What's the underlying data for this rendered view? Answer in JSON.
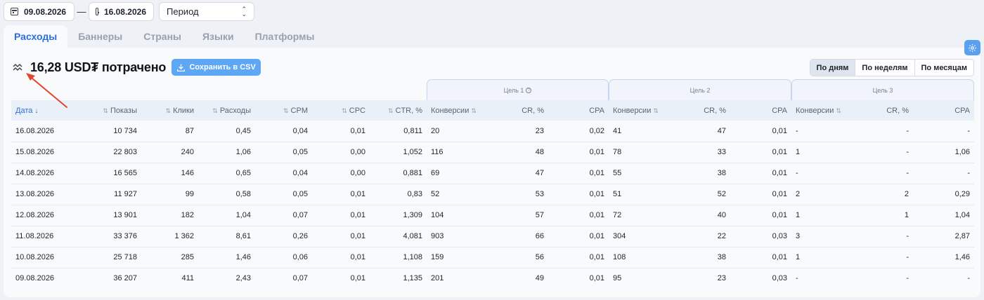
{
  "topbar": {
    "date_from": "09.08.2026",
    "date_to": "16.08.2026",
    "separator": "—",
    "period_placeholder": "Период"
  },
  "tabs": [
    {
      "label": "Расходы",
      "active": true
    },
    {
      "label": "Баннеры",
      "active": false
    },
    {
      "label": "Страны",
      "active": false
    },
    {
      "label": "Языки",
      "active": false
    },
    {
      "label": "Платформы",
      "active": false
    }
  ],
  "summary": {
    "title": "16,28 USD₮ потрачено",
    "csv_button": "Сохранить в CSV"
  },
  "grouping": {
    "options": [
      "По дням",
      "По неделям",
      "По месяцам"
    ],
    "selected": "По дням"
  },
  "goals": [
    "Цель 1",
    "Цель 2",
    "Цель 3"
  ],
  "table": {
    "columns": [
      "Дата",
      "Показы",
      "Клики",
      "Расходы",
      "CPM",
      "CPC",
      "CTR, %",
      "Конверсии",
      "CR, %",
      "CPA",
      "Конверсии",
      "CR, %",
      "CPA",
      "Конверсии",
      "CR, %",
      "CPA"
    ],
    "rows": [
      [
        "16.08.2026",
        "10 734",
        "87",
        "0,45",
        "0,04",
        "0,01",
        "0,811",
        "20",
        "23",
        "0,02",
        "41",
        "47",
        "0,01",
        "-",
        "-",
        "-"
      ],
      [
        "15.08.2026",
        "22 803",
        "240",
        "1,06",
        "0,05",
        "0,00",
        "1,052",
        "116",
        "48",
        "0,01",
        "78",
        "33",
        "0,01",
        "1",
        "-",
        "1,06"
      ],
      [
        "14.08.2026",
        "16 565",
        "146",
        "0,65",
        "0,04",
        "0,00",
        "0,881",
        "69",
        "47",
        "0,01",
        "55",
        "38",
        "0,01",
        "-",
        "-",
        "-"
      ],
      [
        "13.08.2026",
        "11 927",
        "99",
        "0,58",
        "0,05",
        "0,01",
        "0,83",
        "52",
        "53",
        "0,01",
        "51",
        "52",
        "0,01",
        "2",
        "2",
        "0,29"
      ],
      [
        "12.08.2026",
        "13 901",
        "182",
        "1,04",
        "0,07",
        "0,01",
        "1,309",
        "104",
        "57",
        "0,01",
        "72",
        "40",
        "0,01",
        "1",
        "1",
        "1,04"
      ],
      [
        "11.08.2026",
        "33 376",
        "1 362",
        "8,61",
        "0,26",
        "0,01",
        "4,081",
        "903",
        "66",
        "0,01",
        "304",
        "22",
        "0,03",
        "3",
        "-",
        "2,87"
      ],
      [
        "10.08.2026",
        "25 718",
        "285",
        "1,46",
        "0,06",
        "0,01",
        "1,108",
        "159",
        "56",
        "0,01",
        "108",
        "38",
        "0,01",
        "1",
        "-",
        "1,46"
      ],
      [
        "09.08.2026",
        "36 207",
        "411",
        "2,43",
        "0,07",
        "0,01",
        "1,135",
        "201",
        "49",
        "0,01",
        "95",
        "23",
        "0,03",
        "-",
        "-",
        "-"
      ]
    ]
  },
  "colors": {
    "accent": "#2a6fdb",
    "csv_button": "#5ea7f5",
    "annotation_arrow": "#e2462c"
  }
}
